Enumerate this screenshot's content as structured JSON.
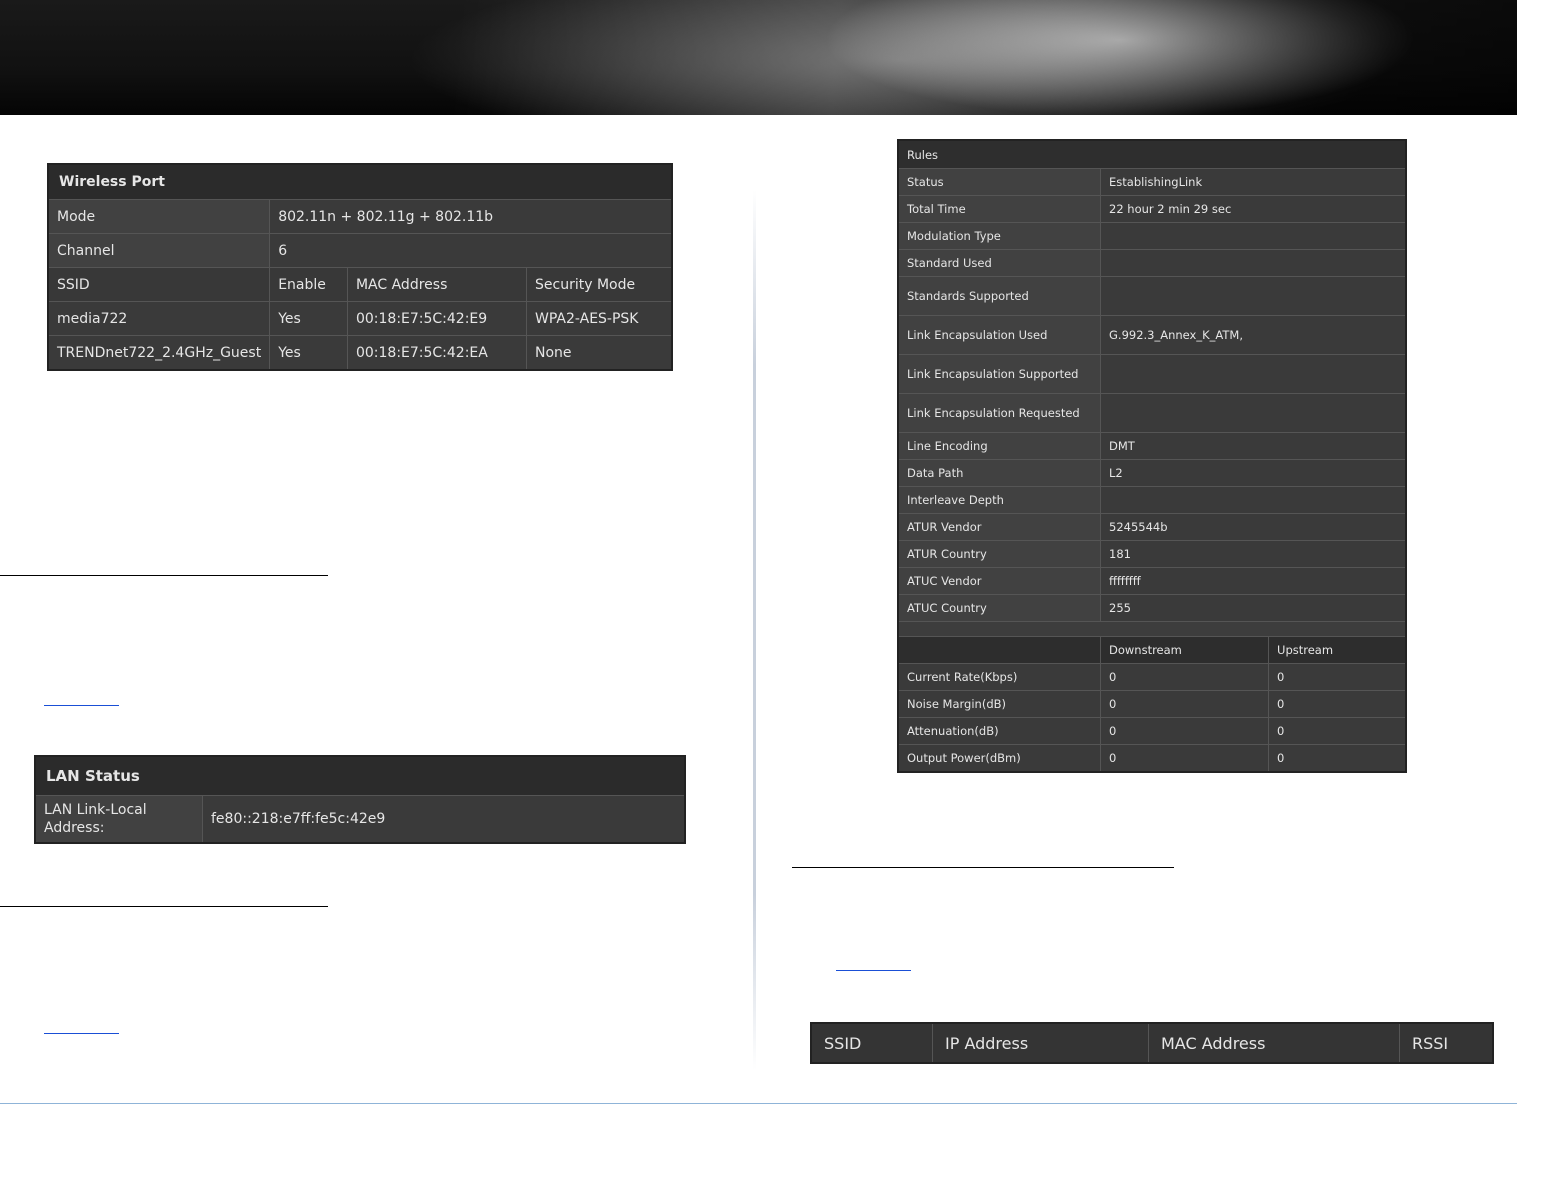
{
  "wireless_port": {
    "title": "Wireless Port",
    "mode_label": "Mode",
    "mode_value": "802.11n + 802.11g + 802.11b",
    "channel_label": "Channel",
    "channel_value": "6",
    "columns": [
      "SSID",
      "Enable",
      "MAC Address",
      "Security Mode"
    ],
    "rows": [
      [
        "media722",
        "Yes",
        "00:18:E7:5C:42:E9",
        "WPA2-AES-PSK"
      ],
      [
        "TRENDnet722_2.4GHz_Guest",
        "Yes",
        "00:18:E7:5C:42:EA",
        "None"
      ]
    ]
  },
  "lan_status": {
    "title": "LAN Status",
    "label": "LAN Link-Local Address:",
    "value": "fe80::218:e7ff:fe5c:42e9"
  },
  "rules": {
    "title": "Rules",
    "rows": [
      [
        "Status",
        "EstablishingLink"
      ],
      [
        "Total Time",
        "22 hour 2 min 29 sec"
      ],
      [
        "Modulation Type",
        ""
      ],
      [
        "Standard Used",
        ""
      ],
      [
        "Standards Supported",
        ""
      ],
      [
        "Link Encapsulation Used",
        "G.992.3_Annex_K_ATM,"
      ],
      [
        "Link Encapsulation Supported",
        ""
      ],
      [
        "Link Encapsulation Requested",
        ""
      ],
      [
        "Line Encoding",
        "DMT"
      ],
      [
        "Data Path",
        "L2"
      ],
      [
        "Interleave Depth",
        ""
      ],
      [
        "ATUR Vendor",
        "5245544b"
      ],
      [
        "ATUR Country",
        "181"
      ],
      [
        "ATUC Vendor",
        "ffffffff"
      ],
      [
        "ATUC Country",
        "255"
      ]
    ],
    "rate_columns": [
      "",
      "Downstream",
      "Upstream"
    ],
    "rate_rows": [
      [
        "Current Rate(Kbps)",
        "0",
        "0"
      ],
      [
        "Noise Margin(dB)",
        "0",
        "0"
      ],
      [
        "Attenuation(dB)",
        "0",
        "0"
      ],
      [
        "Output Power(dBm)",
        "0",
        "0"
      ]
    ]
  },
  "clients": {
    "columns": [
      "SSID",
      "IP Address",
      "MAC Address",
      "RSSI"
    ]
  }
}
